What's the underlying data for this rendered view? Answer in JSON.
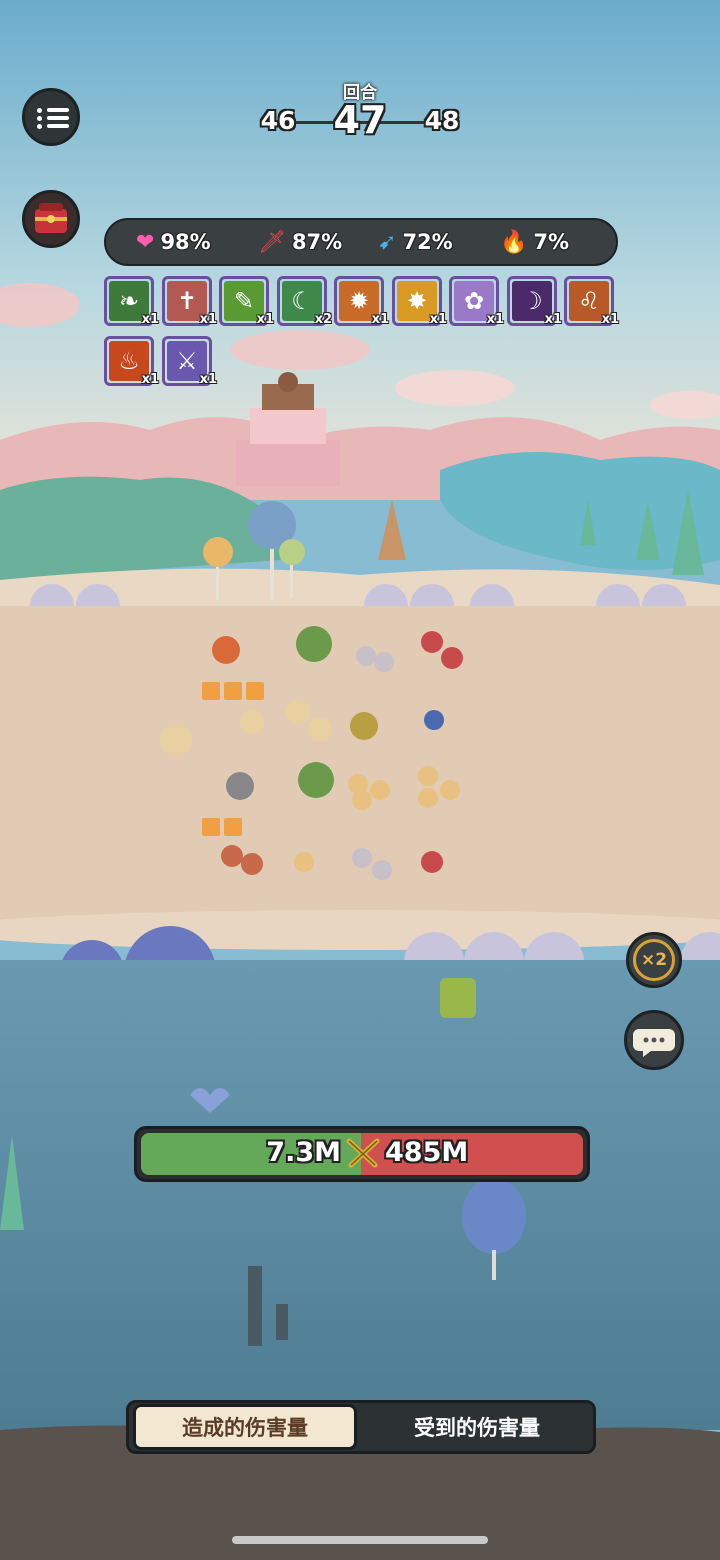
{
  "round": {
    "label": "回合",
    "previous": "46",
    "current": "47",
    "next": "48"
  },
  "stats": [
    {
      "icon": "heart-icon",
      "glyph": "❤",
      "color": "#ff5fae",
      "value": "98%"
    },
    {
      "icon": "sword-icon",
      "glyph": "🗡",
      "color": "#e84a4a",
      "value": "87%"
    },
    {
      "icon": "speed-icon",
      "glyph": "➹",
      "color": "#4ab0e8",
      "value": "72%"
    },
    {
      "icon": "fire-icon",
      "glyph": "🔥",
      "color": "#ff9a2a",
      "value": "7%"
    }
  ],
  "skills": [
    {
      "name": "vine-skill-icon",
      "count": "x1",
      "bg": "#3e7a3a",
      "glyph": "❧"
    },
    {
      "name": "tomb-skill-icon",
      "count": "x1",
      "bg": "#b25a52",
      "glyph": "✝"
    },
    {
      "name": "poison-skill-icon",
      "count": "x1",
      "bg": "#5a9a32",
      "glyph": "✎"
    },
    {
      "name": "moon-heal-skill-icon",
      "count": "x2",
      "bg": "#3f8a4a",
      "glyph": "☾"
    },
    {
      "name": "beast-rage-skill-icon",
      "count": "x1",
      "bg": "#c86a28",
      "glyph": "✹"
    },
    {
      "name": "burst-skill-icon",
      "count": "x1",
      "bg": "#d89a22",
      "glyph": "✸"
    },
    {
      "name": "hamster-skill-icon",
      "count": "x1",
      "bg": "#9a7ac8",
      "glyph": "✿"
    },
    {
      "name": "wolf-skill-icon",
      "count": "x1",
      "bg": "#4a2a6a",
      "glyph": "☽"
    },
    {
      "name": "lion-skill-icon",
      "count": "x1",
      "bg": "#b85a28",
      "glyph": "♌"
    },
    {
      "name": "flame-skill-icon",
      "count": "x1",
      "bg": "#c8481e",
      "glyph": "♨"
    },
    {
      "name": "blade-skill-icon",
      "count": "x1",
      "bg": "#6a58b0",
      "glyph": "⚔"
    }
  ],
  "damage": {
    "dealt": "7.3M",
    "taken": "485M",
    "icon": "crossed-swords-icon"
  },
  "speed_button": {
    "label": "×2"
  },
  "tabs": {
    "dealt": "造成的伤害量",
    "taken": "受到的伤害量"
  },
  "colors": {
    "accent": "#d8a234",
    "dealt_bar": "#64a85a",
    "taken_bar": "#d05050"
  }
}
